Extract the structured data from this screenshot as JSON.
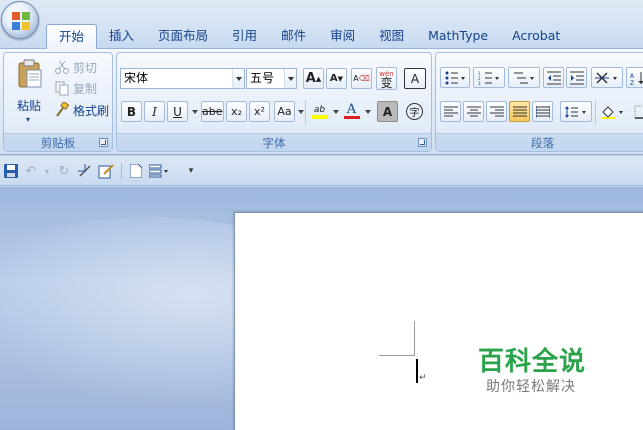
{
  "tabs": [
    {
      "label": "开始",
      "active": true
    },
    {
      "label": "插入"
    },
    {
      "label": "页面布局"
    },
    {
      "label": "引用"
    },
    {
      "label": "邮件"
    },
    {
      "label": "审阅"
    },
    {
      "label": "视图"
    },
    {
      "label": "MathType"
    },
    {
      "label": "Acrobat"
    }
  ],
  "clipboard": {
    "group_label": "剪贴板",
    "paste_label": "粘贴",
    "cut_label": "剪切",
    "copy_label": "复制",
    "format_painter_label": "格式刷"
  },
  "font": {
    "group_label": "字体",
    "font_name": "宋体",
    "font_size": "五号",
    "grow_label": "A",
    "shrink_label": "A",
    "phonetic_label": "wén",
    "phonetic_char": "变",
    "border_char": "A",
    "bold": "B",
    "italic": "I",
    "underline": "U",
    "strikethrough": "abe",
    "subscript": "x₂",
    "superscript": "x²",
    "change_case": "Aa",
    "highlight_label": "ab",
    "font_color_label": "A",
    "shading_char": "A",
    "enclose_char": "字"
  },
  "paragraph": {
    "group_label": "段落"
  },
  "watermark": {
    "title": "百科全说",
    "subtitle": "助你轻松解决"
  },
  "colors": {
    "accent": "#15428b",
    "watermark_green": "#2aa34a",
    "highlight_yellow": "#ffff00",
    "font_red": "#e02020"
  }
}
